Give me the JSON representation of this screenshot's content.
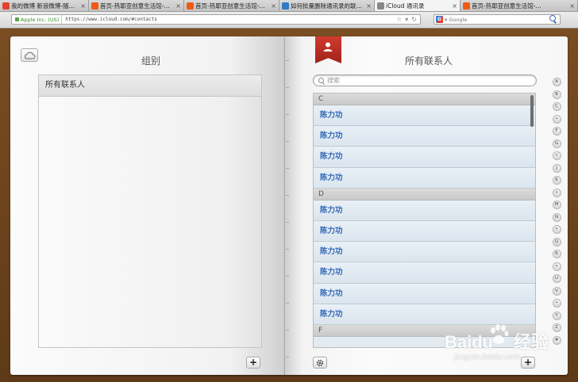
{
  "browser": {
    "tabs": [
      {
        "title": "我的微博 新浪微博-随时…",
        "favicon": "weibo",
        "color": "#e0412c",
        "active": false
      },
      {
        "title": "首页-热耶亚创意生活馆-…",
        "favicon": "taobao",
        "color": "#f05a14",
        "active": false
      },
      {
        "title": "首页-热耶亚创意生活馆-…",
        "favicon": "taobao",
        "color": "#f05a14",
        "active": false
      },
      {
        "title": "如何批量删除通讯录的联…",
        "favicon": "baidu-jingyan",
        "color": "#2f7bc4",
        "active": false
      },
      {
        "title": "iCloud 通讯录",
        "favicon": "apple",
        "color": "#888888",
        "active": true
      },
      {
        "title": "首页-热耶亚创意生活馆-…",
        "favicon": "taobao",
        "color": "#f05a14",
        "active": false
      }
    ],
    "identity": "Apple Inc. (US)",
    "url": "https://www.icloud.com/#contacts",
    "search_placeholder": "Google",
    "search_engine_icon": "G"
  },
  "groups": {
    "title": "组别",
    "items": [
      "所有联系人"
    ]
  },
  "contacts": {
    "title": "所有联系人",
    "search_placeholder": "搜索",
    "sections": [
      {
        "letter": "C",
        "rows": [
          "陈力功",
          "陈力功",
          "陈力功",
          "陈力功"
        ]
      },
      {
        "letter": "D",
        "rows": [
          "陈力功",
          "陈力功",
          "陈力功",
          "陈力功",
          "陈力功",
          "陈力功"
        ]
      },
      {
        "letter": "F",
        "rows": []
      }
    ],
    "alphabet": [
      "A",
      "B",
      "C",
      "•",
      "F",
      "G",
      "•",
      "J",
      "K",
      "•",
      "M",
      "N",
      "•",
      "Q",
      "R",
      "•",
      "U",
      "V",
      "•",
      "Y",
      "Z",
      "#"
    ]
  },
  "watermark": {
    "main": "Baidu",
    "suffix": "经验",
    "sub": "jingyan.baidu.com"
  },
  "colors": {
    "book_leather": "#6b4420",
    "ribbon_red": "#c23327",
    "contact_name_blue": "#2f67b7"
  }
}
